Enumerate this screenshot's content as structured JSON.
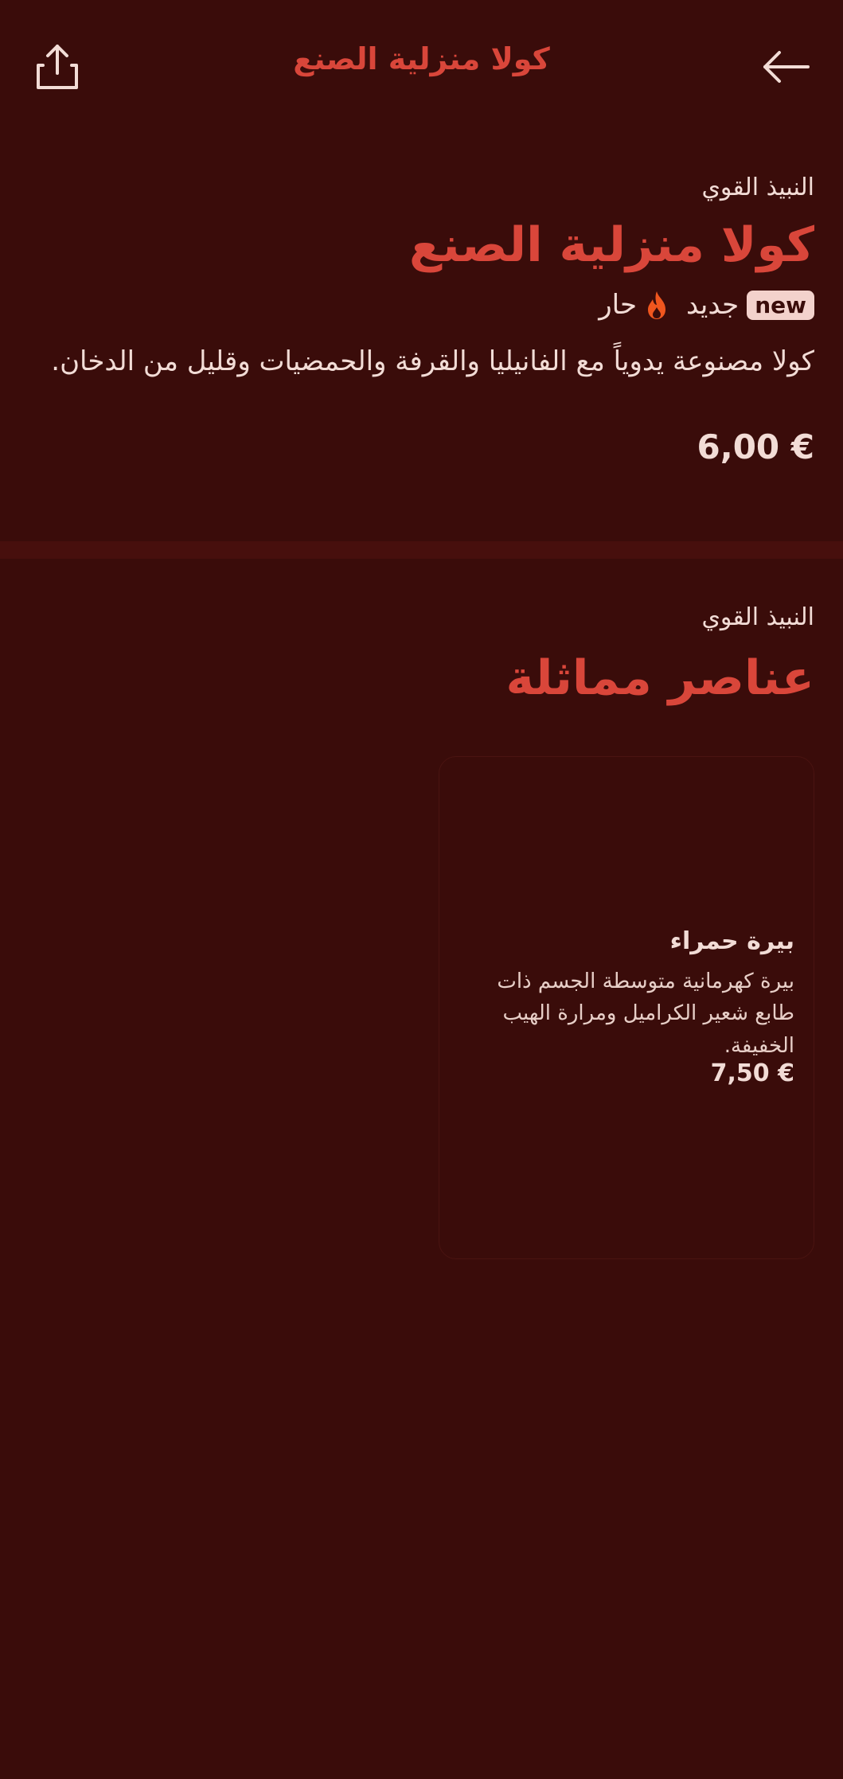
{
  "header": {
    "title": "كولا منزلية الصنع",
    "share_icon": "share-icon",
    "back_icon": "arrow-left-icon"
  },
  "product": {
    "category": "النبيذ القوي",
    "name": "كولا منزلية الصنع",
    "tags": [
      {
        "badge": "new",
        "label": "جديد"
      },
      {
        "icon": "fire-icon",
        "label": "حار"
      }
    ],
    "description": "كولا مصنوعة يدوياً مع الفانيليا والقرفة والحمضيات وقليل من الدخان.",
    "price": "6,00 €"
  },
  "similar": {
    "category": "النبيذ القوي",
    "title": "عناصر مماثلة",
    "items": [
      {
        "name": "بيرة حمراء",
        "description": "بيرة كهرمانية متوسطة الجسم ذات طابع شعير الكراميل ومرارة الهيب الخفيفة.",
        "price": "7,50 €"
      }
    ]
  },
  "colors": {
    "background": "#3a0c0a",
    "accent": "#d9463a",
    "text": "#f2dcd6",
    "fire": "#f0561e"
  }
}
